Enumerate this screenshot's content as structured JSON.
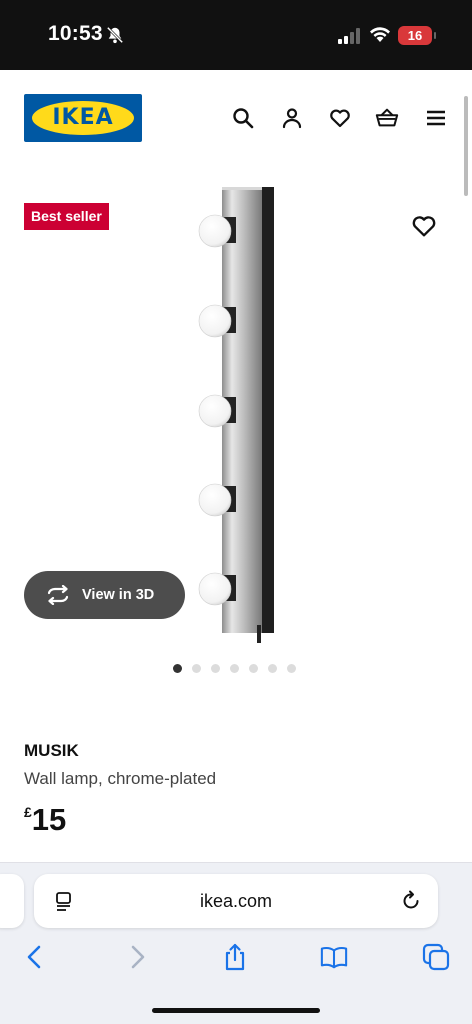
{
  "status": {
    "time": "10:53",
    "battery": "16",
    "icons": [
      "bell-slash-icon",
      "signal-icon",
      "wifi-icon",
      "battery-icon"
    ]
  },
  "header": {
    "logo_text": "IKEA",
    "icons": [
      "search-icon",
      "account-icon",
      "heart-icon",
      "basket-icon",
      "menu-icon"
    ],
    "colors": {
      "brand_blue": "#0058a3",
      "brand_yellow": "#ffda1a"
    }
  },
  "product": {
    "badge": "Best seller",
    "badge_color": "#cc0033",
    "view3d_label": "View in 3D",
    "carousel": {
      "count": 7,
      "active": 1
    },
    "name": "MUSIK",
    "description": "Wall lamp, chrome-plated",
    "price_currency": "£",
    "price_value": "15"
  },
  "browser": {
    "url": "ikea.com",
    "buttons": [
      "back-icon",
      "forward-icon",
      "share-icon",
      "bookmarks-icon",
      "tabs-icon"
    ],
    "accent": "#1a73e8"
  }
}
